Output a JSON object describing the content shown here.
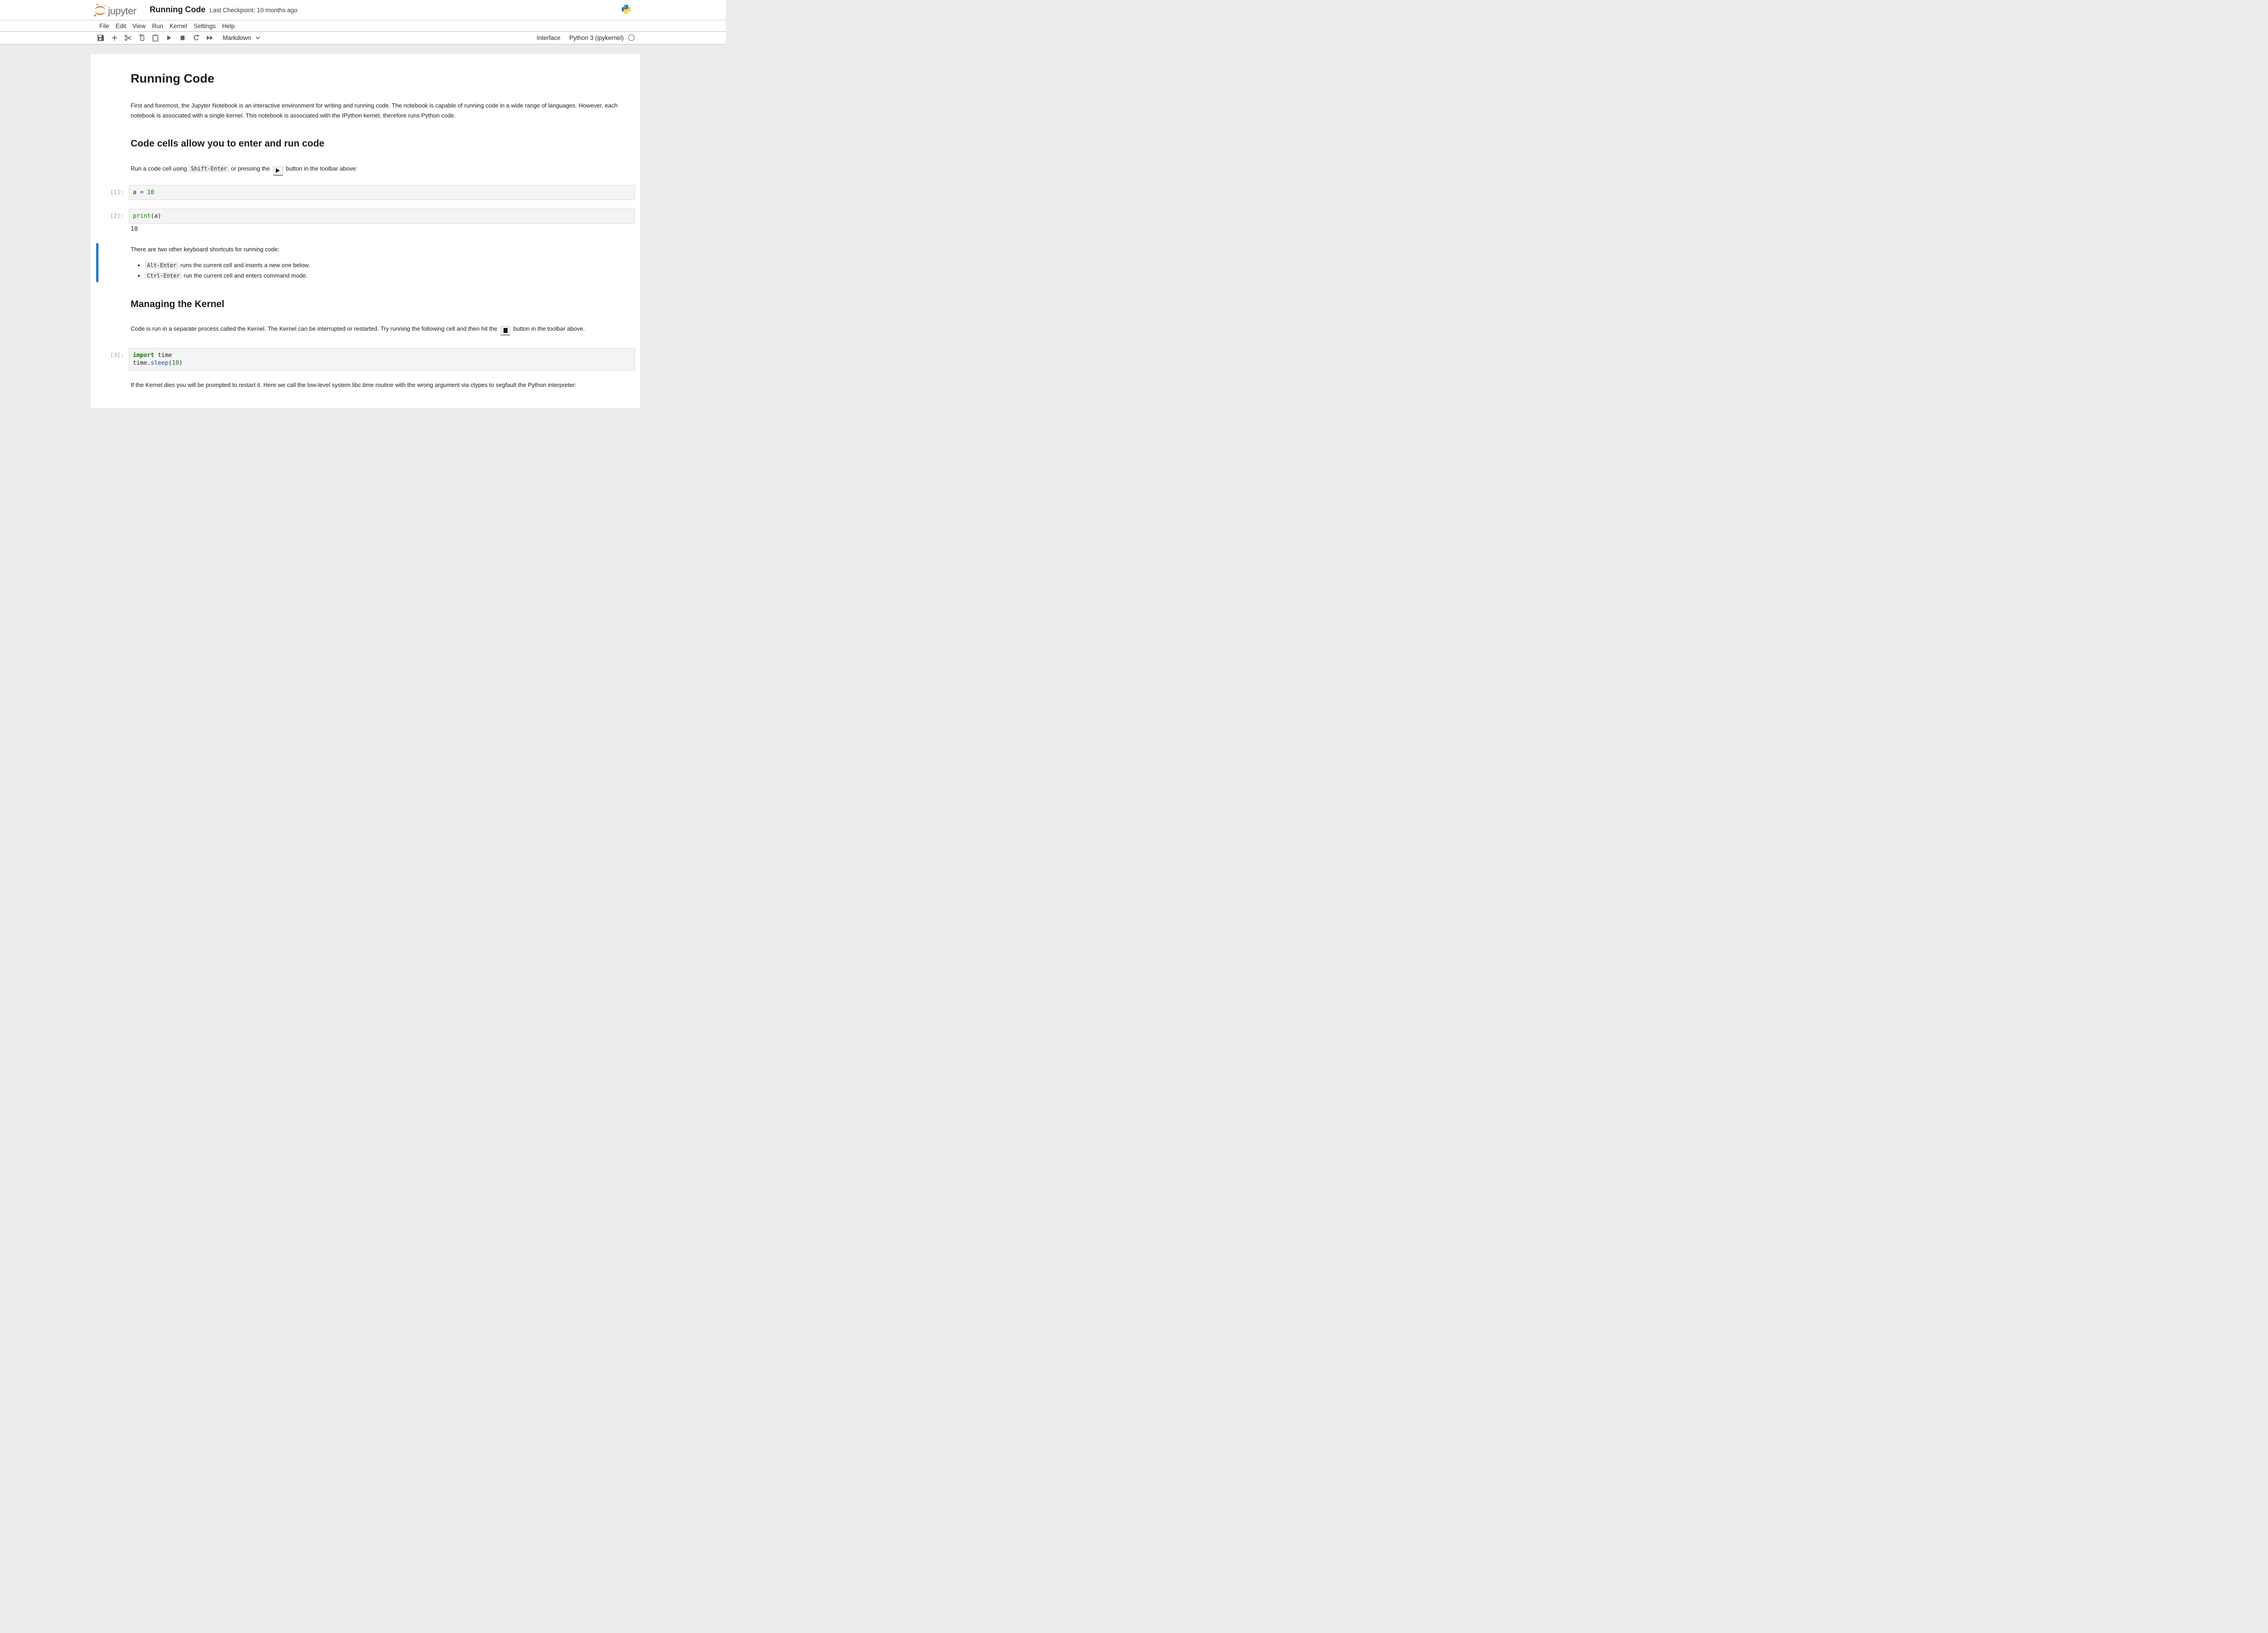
{
  "colors": {
    "selected_cell_bar": "#1976d2",
    "jupyter_orange": "#f37726",
    "logo_gray": "#6d6d6d",
    "toolbar_icon_gray": "#616161",
    "code_keyword_green": "#008000",
    "code_builtin_green": "#008000",
    "code_number_green": "#008000",
    "code_operator_purple": "#aa22ff",
    "code_property_blue": "#0055aa",
    "cell_editor_bg": "#f4f4f4",
    "page_bg": "#ffffff",
    "app_bg": "#ececec",
    "python_blue": "#3776ab",
    "python_yellow": "#ffd43b"
  },
  "header": {
    "logo_text": "jupyter",
    "title": "Running Code",
    "checkpoint": "Last Checkpoint: 10 months ago"
  },
  "menu": {
    "items": [
      "File",
      "Edit",
      "View",
      "Run",
      "Kernel",
      "Settings",
      "Help"
    ]
  },
  "toolbar": {
    "icon_names": [
      "save-icon",
      "insert-cell-below-icon",
      "cut-cells-icon",
      "copy-cells-icon",
      "paste-cells-icon",
      "run-cell-icon",
      "interrupt-kernel-icon",
      "restart-kernel-icon",
      "restart-and-run-all-icon"
    ],
    "cell_type": "Markdown",
    "interface_label": "Interface",
    "kernel_name": "Python 3 (ipykernel)",
    "kernel_status_icon": "kernel-idle-circle"
  },
  "notebook": {
    "title_heading": "Running Code",
    "intro": "First and foremost, the Jupyter Notebook is an interactive environment for writing and running code. The notebook is capable of running code in a wide range of languages. However, each notebook is associated with a single kernel. This notebook is associated with the IPython kernel, therefore runs Python code.",
    "cells_heading": "Code cells allow you to enter and run code",
    "run_line": {
      "before": "Run a code cell using ",
      "kbd": "Shift-Enter",
      "between": " or pressing the ",
      "after": " button in the toolbar above:"
    },
    "code_cells": [
      {
        "prompt": "[1]:",
        "lines": [
          [
            [
              "plain",
              "a "
            ],
            [
              "op",
              "="
            ],
            [
              "plain",
              " "
            ],
            [
              "num",
              "10"
            ]
          ]
        ],
        "output": ""
      },
      {
        "prompt": "[2]:",
        "lines": [
          [
            [
              "builtin",
              "print"
            ],
            [
              "plain",
              "(a)"
            ]
          ]
        ],
        "output": "10"
      },
      {
        "prompt": "[3]:",
        "lines": [
          [
            [
              "kw",
              "import"
            ],
            [
              "plain",
              " time"
            ]
          ],
          [
            [
              "plain",
              "time."
            ],
            [
              "prop",
              "sleep"
            ],
            [
              "plain",
              "("
            ],
            [
              "num",
              "10"
            ],
            [
              "plain",
              ")"
            ]
          ]
        ],
        "output": ""
      }
    ],
    "shortcuts_intro": "There are two other keyboard shortcuts for running code:",
    "shortcuts": [
      {
        "kbd": "Alt-Enter",
        "text": " runs the current cell and inserts a new one below."
      },
      {
        "kbd": "Ctrl-Enter",
        "text": " run the current cell and enters command mode."
      }
    ],
    "kernel_heading": "Managing the Kernel",
    "kernel_para": {
      "before": "Code is run in a separate process called the Kernel. The Kernel can be interrupted or restarted. Try running the following cell and then hit the ",
      "after": " button in the toolbar above."
    },
    "final_para": "If the Kernel dies you will be prompted to restart it. Here we call the low-level system libc.time routine with the wrong argument via ctypes to segfault the Python interpreter:"
  }
}
